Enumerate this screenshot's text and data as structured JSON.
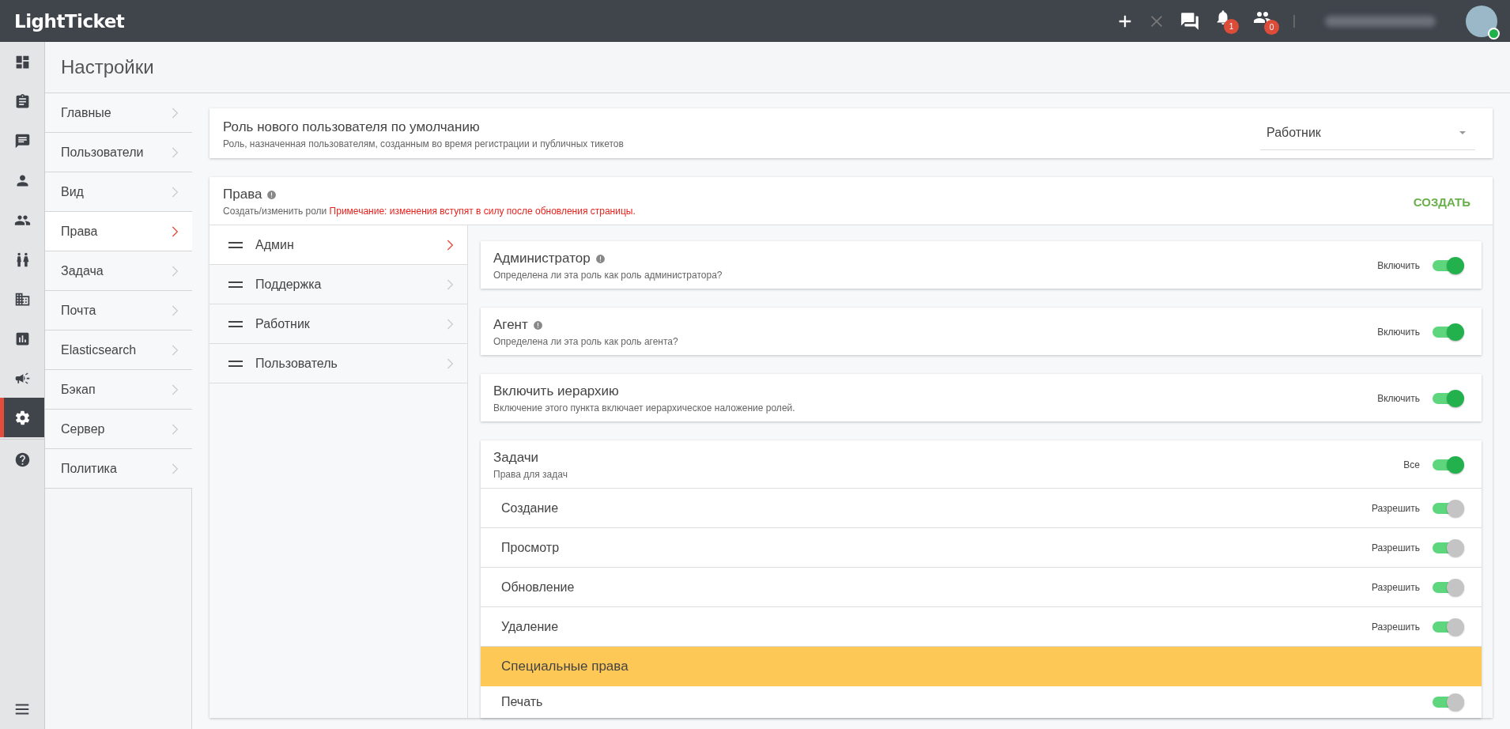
{
  "topbar": {
    "logo": "LightTicket",
    "notifications": "1",
    "contacts": "0",
    "user_online": true
  },
  "rail": [
    {
      "kind": "dashboard",
      "selected": false
    },
    {
      "kind": "clipboard",
      "selected": false
    },
    {
      "kind": "chat",
      "selected": false
    },
    {
      "kind": "person",
      "selected": false
    },
    {
      "kind": "people",
      "selected": false
    },
    {
      "kind": "pair",
      "selected": false
    },
    {
      "kind": "building",
      "selected": false
    },
    {
      "kind": "chart",
      "selected": false
    },
    {
      "kind": "megaphone",
      "selected": false
    },
    {
      "kind": "gear",
      "selected": true
    },
    {
      "kind": "help",
      "selected": false
    }
  ],
  "page_title": "Настройки",
  "settings_nav": [
    {
      "label": "Главные",
      "selected": false
    },
    {
      "label": "Пользователи",
      "selected": false
    },
    {
      "label": "Вид",
      "selected": false
    },
    {
      "label": "Права",
      "selected": true
    },
    {
      "label": "Задача",
      "selected": false
    },
    {
      "label": "Почта",
      "selected": false
    },
    {
      "label": "Elasticsearch",
      "selected": false
    },
    {
      "label": "Бэкап",
      "selected": false
    },
    {
      "label": "Сервер",
      "selected": false
    },
    {
      "label": "Политика",
      "selected": false
    }
  ],
  "default_role": {
    "title": "Роль нового пользователя по умолчанию",
    "description": "Роль, назначенная пользователям, созданным во время регистрации и публичных тикетов",
    "value": "Работник"
  },
  "permissions": {
    "title": "Права",
    "description": "Создать/изменить роли",
    "note": "Примечание: изменения вступят в силу после обновления страницы.",
    "create_button": "СОЗДАТЬ",
    "roles": [
      {
        "label": "Админ",
        "selected": true
      },
      {
        "label": "Поддержка",
        "selected": false
      },
      {
        "label": "Работник",
        "selected": false
      },
      {
        "label": "Пользователь",
        "selected": false
      }
    ],
    "settings": [
      {
        "title": "Администратор",
        "info": true,
        "description": "Определена ли эта роль как роль администратора?",
        "toggle_label": "Включить",
        "on": true
      },
      {
        "title": "Агент",
        "info": true,
        "description": "Определена ли эта роль как роль агента?",
        "toggle_label": "Включить",
        "on": true
      },
      {
        "title": "Включить иерархию",
        "info": false,
        "description": "Включение этого пункта включает иерархическое наложение ролей.",
        "toggle_label": "Включить",
        "on": true
      }
    ],
    "tasks": {
      "title": "Задачи",
      "description": "Права для задач",
      "toggle_label": "Все",
      "on": true,
      "items": [
        {
          "label": "Создание",
          "toggle_label": "Разрешить",
          "on": true,
          "disabled": true
        },
        {
          "label": "Просмотр",
          "toggle_label": "Разрешить",
          "on": true,
          "disabled": true
        },
        {
          "label": "Обновление",
          "toggle_label": "Разрешить",
          "on": true,
          "disabled": true
        },
        {
          "label": "Удаление",
          "toggle_label": "Разрешить",
          "on": true,
          "disabled": true
        }
      ]
    },
    "special": {
      "title": "Специальные права",
      "items": [
        {
          "label": "Печать",
          "on": true,
          "disabled": true
        }
      ]
    }
  }
}
